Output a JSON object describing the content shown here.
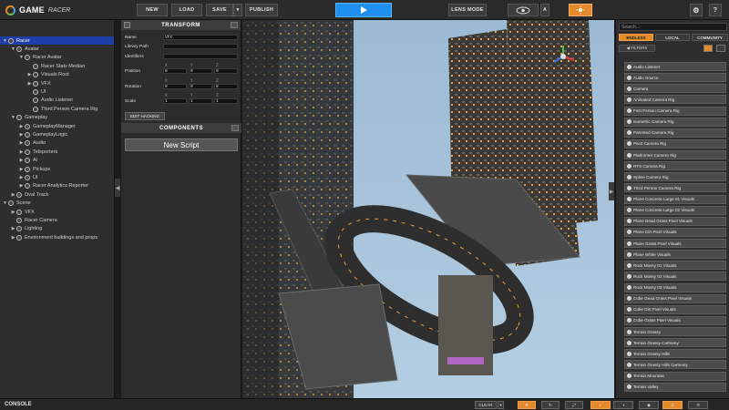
{
  "toolbar": {
    "logo_title": "GAME",
    "logo_subtitle": "RACER",
    "new_label": "NEW",
    "load_label": "LOAD",
    "save_label": "SAVE",
    "publish_label": "PUBLISH",
    "lens_mode_label": "LENS MODE",
    "view_key_label": "A",
    "play_color": "#1f8ff0",
    "accent_color": "#e48a2a"
  },
  "hierarchy": {
    "rows": [
      {
        "label": "Racer",
        "depth": 0,
        "arrow": "▼",
        "selected": true
      },
      {
        "label": "Avatar",
        "depth": 1,
        "arrow": "▼"
      },
      {
        "label": "Racer Avatar",
        "depth": 2,
        "arrow": "▼"
      },
      {
        "label": "Racer Stats Median",
        "depth": 3,
        "arrow": ""
      },
      {
        "label": "Visuals Root",
        "depth": 3,
        "arrow": "▶"
      },
      {
        "label": "VFX",
        "depth": 3,
        "arrow": "▶"
      },
      {
        "label": "UI",
        "depth": 3,
        "arrow": ""
      },
      {
        "label": "Audio Listener",
        "depth": 3,
        "arrow": ""
      },
      {
        "label": "Third Person Camera Rig",
        "depth": 3,
        "arrow": ""
      },
      {
        "label": "Gameplay",
        "depth": 1,
        "arrow": "▼"
      },
      {
        "label": "GameplayManager",
        "depth": 2,
        "arrow": "▶"
      },
      {
        "label": "GameplayLogic",
        "depth": 2,
        "arrow": "▶"
      },
      {
        "label": "Audio",
        "depth": 2,
        "arrow": "▶"
      },
      {
        "label": "Teleporters",
        "depth": 2,
        "arrow": "▶"
      },
      {
        "label": "AI",
        "depth": 2,
        "arrow": "▶"
      },
      {
        "label": "Pickups",
        "depth": 2,
        "arrow": "▶"
      },
      {
        "label": "UI",
        "depth": 2,
        "arrow": "▶"
      },
      {
        "label": "Racer Analytics Reporter",
        "depth": 2,
        "arrow": "▶"
      },
      {
        "label": "Oval Track",
        "depth": 1,
        "arrow": "▶"
      },
      {
        "label": "Scene",
        "depth": 0,
        "arrow": "▼"
      },
      {
        "label": "VFX",
        "depth": 1,
        "arrow": "▶"
      },
      {
        "label": "Racer Camera",
        "depth": 1,
        "arrow": ""
      },
      {
        "label": "Lighting",
        "depth": 1,
        "arrow": "▶"
      },
      {
        "label": "Environment buildings and props",
        "depth": 1,
        "arrow": "▶"
      }
    ]
  },
  "inspector": {
    "transform_title": "TRANSFORM",
    "name_label": "Name",
    "name_value": "VFX",
    "library_path_label": "Library Path",
    "identifiers_label": "Identifiers",
    "position_label": "Position",
    "rotation_label": "Rotation",
    "scale_label": "Scale",
    "axis_x": "X",
    "axis_y": "Y",
    "axis_z": "Z",
    "position": [
      "0",
      "0",
      "0"
    ],
    "rotation": [
      "0",
      "0",
      "0"
    ],
    "scale": [
      "1",
      "1",
      "1"
    ],
    "edit_button": "EDIT HACKING",
    "components_title": "COMPONENTS",
    "new_script_label": "New Script"
  },
  "library": {
    "search_placeholder": "Search...",
    "tabs": [
      "ENDLESS",
      "LOCAL",
      "COMMUNITY"
    ],
    "filters_label": "◀ FILTERS",
    "items": [
      "Audio Listener",
      "Audio Source",
      "Camera",
      "Animated Camera Rig",
      "First Person Camera Rig",
      "Isometric Camera Rig",
      "Parented Camera Rig",
      "Pivot Camera Rig",
      "Platformer Camera Rig",
      "RTS Camera Rig",
      "Spline Camera Rig",
      "Third Person Camera Rig",
      "Plane Concrete Large 01 Visuals",
      "Plane Concrete Large 02 Visuals",
      "Plane Dead Grass Pixel Visuals",
      "Plane Dirt Pixel Visuals",
      "Plane Grass Pixel Visuals",
      "Plane White Visuals",
      "Rock Mossy 01 Visuals",
      "Rock Mossy 02 Visuals",
      "Rock Mossy 03 Visuals",
      "Cube Dead Grass Pixel Visuals",
      "Cube Dirt Pixel Visuals",
      "Cube Grass Pixel Visuals",
      "Terrain Grassy",
      "Terrain Grassy Cartoony",
      "Terrain Grassy Hills",
      "Terrain Grassy Hills Cartoony",
      "Terrain Mountain",
      "Terrain Valley"
    ]
  },
  "console": {
    "label": "CONSOLE",
    "clear_label": "CLEAR"
  },
  "viewport": {
    "sky_color": "#a8c4dc",
    "accent_light_color": "#e8a040",
    "neon_color": "#c86ae0"
  }
}
